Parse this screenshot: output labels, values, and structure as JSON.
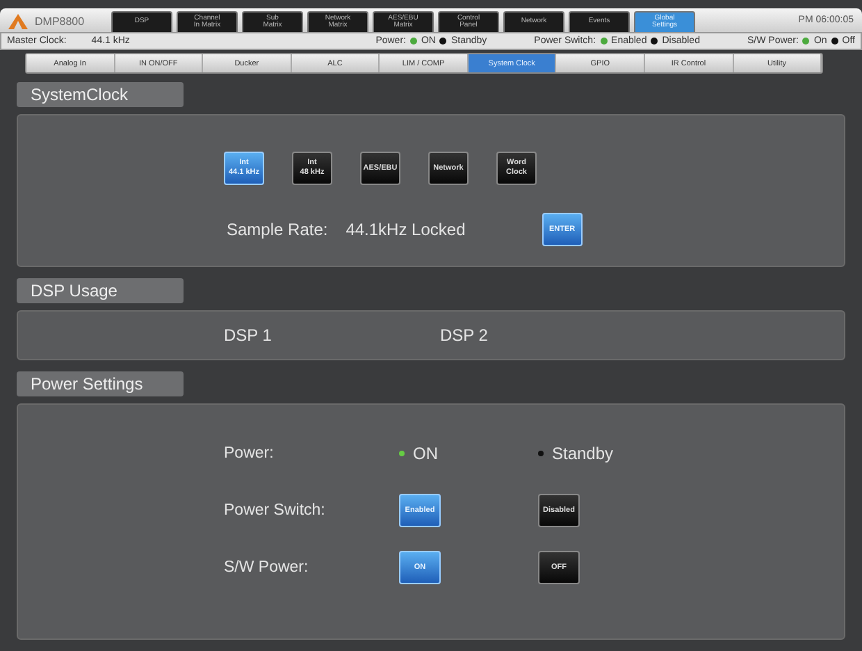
{
  "app": {
    "name": "DMP8800",
    "time": "PM 06:00:05"
  },
  "main_tabs": [
    {
      "label": "DSP",
      "selected": false
    },
    {
      "label": "Channel\nIn Matrix",
      "selected": false
    },
    {
      "label": "Sub\nMatrix",
      "selected": false
    },
    {
      "label": "Network\nMatrix",
      "selected": false
    },
    {
      "label": "AES/EBU\nMatrix",
      "selected": false
    },
    {
      "label": "Control\nPanel",
      "selected": false
    },
    {
      "label": "Network",
      "selected": false
    },
    {
      "label": "Events",
      "selected": false
    },
    {
      "label": "Global\nSettings",
      "selected": true
    }
  ],
  "status_bar": {
    "master_clock_label": "Master Clock:",
    "master_clock": "44.1 kHz",
    "groups": [
      {
        "label": "Power:",
        "options": [
          {
            "label": "ON",
            "selected": true
          },
          {
            "label": "Standby",
            "selected": false
          }
        ]
      },
      {
        "label": "Power Switch:",
        "options": [
          {
            "label": "Enabled",
            "selected": true
          },
          {
            "label": "Disabled",
            "selected": false
          }
        ]
      },
      {
        "label": "S/W Power:",
        "options": [
          {
            "label": "On",
            "selected": true
          },
          {
            "label": "Off",
            "selected": false
          }
        ]
      }
    ]
  },
  "sub_tabs": [
    {
      "label": "Analog In",
      "selected": false
    },
    {
      "label": "IN ON/OFF",
      "selected": false
    },
    {
      "label": "Ducker",
      "selected": false
    },
    {
      "label": "ALC",
      "selected": false
    },
    {
      "label": "LIM / COMP",
      "selected": false
    },
    {
      "label": "System Clock",
      "selected": true
    },
    {
      "label": "GPIO",
      "selected": false
    },
    {
      "label": "IR Control",
      "selected": false
    },
    {
      "label": "Utility",
      "selected": false
    }
  ],
  "system_clock": {
    "title": "SystemClock",
    "sources": [
      {
        "label": "Int\n44.1 kHz",
        "selected": true
      },
      {
        "label": "Int\n48 kHz",
        "selected": false
      },
      {
        "label": "AES/EBU",
        "selected": false
      },
      {
        "label": "Network",
        "selected": false
      },
      {
        "label": "Word\nClock",
        "selected": false
      }
    ],
    "sample_rate_label": "Sample Rate:",
    "sample_rate": "44.1kHz Locked",
    "enter_button": "ENTER"
  },
  "dsp_usage": {
    "title": "DSP Usage",
    "items": [
      "DSP 1",
      "DSP 2"
    ]
  },
  "power_settings": {
    "title": "Power Settings",
    "rows": [
      {
        "kind": "radio",
        "label": "Power:",
        "options": [
          {
            "label": "ON",
            "selected": true
          },
          {
            "label": "Standby",
            "selected": false
          }
        ]
      },
      {
        "kind": "buttons",
        "label": "Power Switch:",
        "options": [
          {
            "label": "Enabled",
            "selected": true
          },
          {
            "label": "Disabled",
            "selected": false
          }
        ]
      },
      {
        "kind": "buttons",
        "label": "S/W Power:",
        "options": [
          {
            "label": "ON",
            "selected": true
          },
          {
            "label": "OFF",
            "selected": false
          }
        ]
      }
    ]
  }
}
